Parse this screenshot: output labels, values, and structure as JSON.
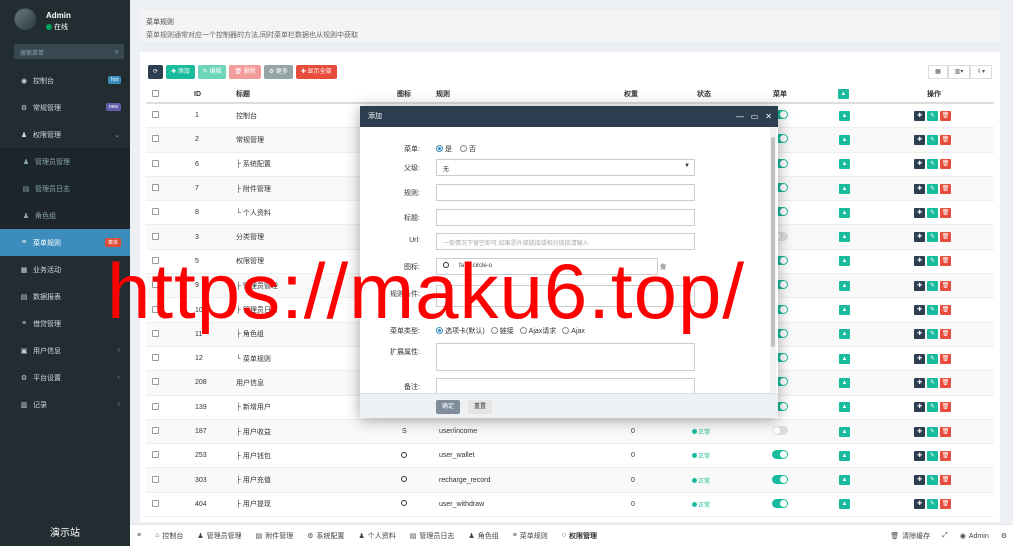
{
  "sidebar": {
    "user_name": "Admin",
    "user_status": "在线",
    "search_placeholder": "搜索菜单",
    "items": [
      {
        "label": "控制台",
        "badge": "hot",
        "badge_color": "#3c8dbc"
      },
      {
        "label": "常规管理",
        "badge": "new",
        "badge_color": "#605ca8"
      },
      {
        "label": "权限管理",
        "chevron": "⌄"
      },
      {
        "label": "管理员管理",
        "sub": true
      },
      {
        "label": "管理员日志",
        "sub": true
      },
      {
        "label": "角色组",
        "sub": true
      },
      {
        "label": "菜单规则",
        "active": true,
        "badge": "菜单",
        "badge_color": "#dd4b39"
      },
      {
        "label": "业务活动"
      },
      {
        "label": "数据报表",
        "chevron": "‹"
      },
      {
        "label": "借贷管理"
      },
      {
        "label": "用户信息",
        "chevron": "‹"
      },
      {
        "label": "平台设置",
        "chevron": "‹"
      },
      {
        "label": "记录",
        "chevron": "‹"
      }
    ],
    "footer": "演示站"
  },
  "header": {
    "title": "菜单规则",
    "description": "菜单规则通常对应一个控制器的方法,同时菜单栏数据也从规则中获取"
  },
  "toolbar": {
    "add": "添加",
    "edit": "编辑",
    "delete": "删除",
    "more": "更多",
    "expand_all": "显示全部",
    "colors": {
      "refresh": "#2c3e50",
      "add": "#18bc9c",
      "edit": "#6dd5b8",
      "delete": "#f39c9c",
      "more": "#95a5a6",
      "expand": "#e74c3c"
    }
  },
  "table": {
    "headers": {
      "id": "ID",
      "title": "标题",
      "icon": "图标",
      "rule": "规则",
      "weigh": "权重",
      "status": "状态",
      "menu": "菜单",
      "operate": "操作"
    },
    "rows": [
      {
        "id": "1",
        "title": "控制台",
        "icon": "",
        "rule": "",
        "weigh": "",
        "status": "",
        "menu_on": true
      },
      {
        "id": "2",
        "title": "常规管理",
        "icon": "",
        "rule": "",
        "weigh": "",
        "status": "",
        "menu_on": true
      },
      {
        "id": "6",
        "title": "├ 系统配置",
        "icon": "",
        "rule": "",
        "weigh": "",
        "status": "",
        "menu_on": true
      },
      {
        "id": "7",
        "title": "├ 附件管理",
        "icon": "",
        "rule": "",
        "weigh": "",
        "status": "",
        "menu_on": true
      },
      {
        "id": "8",
        "title": "└ 个人资料",
        "icon": "",
        "rule": "",
        "weigh": "",
        "status": "",
        "menu_on": true
      },
      {
        "id": "3",
        "title": "分类管理",
        "icon": "",
        "rule": "",
        "weigh": "",
        "status": "",
        "menu_on": false
      },
      {
        "id": "5",
        "title": "权限管理",
        "icon": "",
        "rule": "",
        "weigh": "",
        "status": "",
        "menu_on": true
      },
      {
        "id": "9",
        "title": "├ 管理员管理",
        "icon": "",
        "rule": "",
        "weigh": "",
        "status": "",
        "menu_on": true
      },
      {
        "id": "10",
        "title": "├ 管理员日志",
        "icon": "",
        "rule": "",
        "weigh": "",
        "status": "",
        "menu_on": true
      },
      {
        "id": "11",
        "title": "├ 角色组",
        "icon": "",
        "rule": "",
        "weigh": "",
        "status": "",
        "menu_on": true
      },
      {
        "id": "12",
        "title": "└ 菜单规则",
        "icon": "",
        "rule": "",
        "weigh": "",
        "status": "",
        "menu_on": true
      },
      {
        "id": "208",
        "title": "用户信息",
        "icon": "",
        "rule": "",
        "weigh": "",
        "status": "",
        "menu_on": true
      },
      {
        "id": "139",
        "title": "├ 新增用户",
        "icon": "",
        "rule": "",
        "weigh": "",
        "status": "",
        "menu_on": true
      },
      {
        "id": "187",
        "title": "├ 用户收益",
        "icon": "S",
        "rule": "user/income",
        "weigh": "0",
        "status": "正常",
        "menu_on": false
      },
      {
        "id": "253",
        "title": "├ 用户钱包",
        "icon": "circle",
        "rule": "user_wallet",
        "weigh": "0",
        "status": "正常",
        "menu_on": true
      },
      {
        "id": "303",
        "title": "├ 用户充值",
        "icon": "circle",
        "rule": "recharge_record",
        "weigh": "0",
        "status": "正常",
        "menu_on": true
      },
      {
        "id": "404",
        "title": "├ 用户提现",
        "icon": "circle",
        "rule": "user_withdraw",
        "weigh": "0",
        "status": "正常",
        "menu_on": true
      }
    ]
  },
  "modal": {
    "title": "添加",
    "fields": {
      "ismenu_label": "菜单:",
      "ismenu_yes": "是",
      "ismenu_no": "否",
      "parent_label": "父级:",
      "parent_value": "无",
      "rule_label": "规则:",
      "title_label": "标题:",
      "url_label": "Url:",
      "url_placeholder": "一般情况下留空即可,如果是外部链接或相对链接请输入",
      "icon_label": "图标:",
      "icon_value": "fa fa-circle-o",
      "icon_search": "搜",
      "condition_label": "规则条件:",
      "menutype_label": "菜单类型:",
      "menutype_options": [
        "选项卡(默认)",
        "链接",
        "Ajax请求",
        "Ajax"
      ],
      "extend_label": "扩展属性:",
      "remark_label": "备注:"
    },
    "ok": "确定",
    "reset": "重置"
  },
  "watermark": "https://maku6.top/",
  "footer_tabs": [
    {
      "label": "控制台",
      "icon": "⌂"
    },
    {
      "label": "管理员管理",
      "icon": "♟"
    },
    {
      "label": "附件管理",
      "icon": "▤"
    },
    {
      "label": "系统配置",
      "icon": "⚙"
    },
    {
      "label": "个人资料",
      "icon": "♟"
    },
    {
      "label": "管理员日志",
      "icon": "▤"
    },
    {
      "label": "角色组",
      "icon": "♟"
    },
    {
      "label": "菜单规则",
      "icon": "≡"
    },
    {
      "label": "权限管理",
      "icon": "○",
      "active": true
    }
  ],
  "footer_right": {
    "clear": "清除缓存",
    "user": "Admin"
  }
}
